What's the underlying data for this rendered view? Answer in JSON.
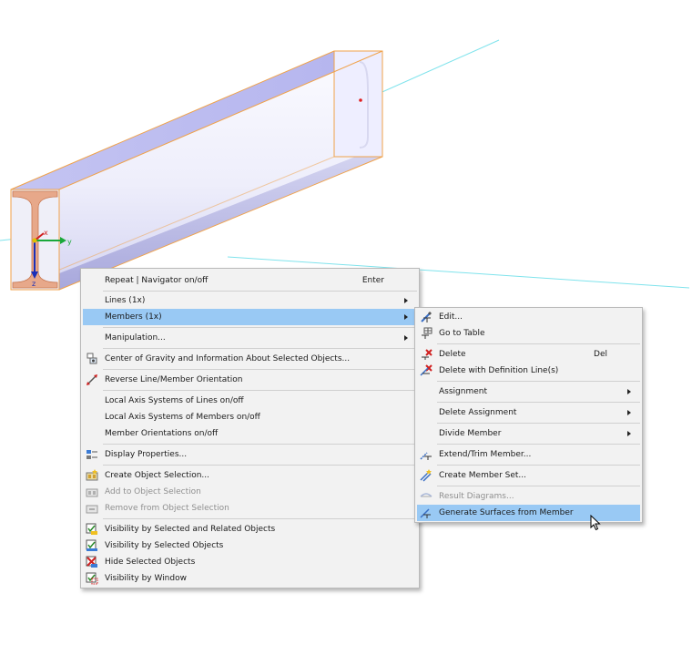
{
  "viewport": {
    "axis_labels": {
      "x": "x",
      "y": "y",
      "z": "z"
    }
  },
  "context_menu": {
    "repeat": {
      "label": "Repeat | Navigator on/off",
      "shortcut": "Enter"
    },
    "lines": "Lines (1x)",
    "members": "Members (1x)",
    "manipulation": "Manipulation...",
    "center_of_gravity": "Center of Gravity and Information About Selected Objects...",
    "reverse_orientation": "Reverse Line/Member Orientation",
    "local_axis_lines": "Local Axis Systems of Lines on/off",
    "local_axis_members": "Local Axis Systems of Members on/off",
    "member_orientations": "Member Orientations on/off",
    "display_properties": "Display Properties...",
    "create_selection": "Create Object Selection...",
    "add_selection": "Add to Object Selection",
    "remove_selection": "Remove from Object Selection",
    "visibility_related": "Visibility by Selected and Related Objects",
    "visibility_selected": "Visibility by Selected Objects",
    "hide_selected": "Hide Selected Objects",
    "visibility_window": "Visibility by Window"
  },
  "submenu": {
    "edit": "Edit...",
    "go_to_table": "Go to Table",
    "delete": {
      "label": "Delete",
      "shortcut": "Del"
    },
    "delete_with_lines": "Delete with Definition Line(s)",
    "assignment": "Assignment",
    "delete_assignment": "Delete Assignment",
    "divide_member": "Divide Member",
    "extend_trim": "Extend/Trim Member...",
    "create_member_set": "Create Member Set...",
    "result_diagrams": "Result Diagrams...",
    "generate_surfaces": "Generate Surfaces from Member"
  },
  "colors": {
    "highlight": "#99c9f4",
    "menu_bg": "#f2f2f2",
    "beam_face": "#c9c9f4",
    "beam_outline": "#f0a24a"
  }
}
